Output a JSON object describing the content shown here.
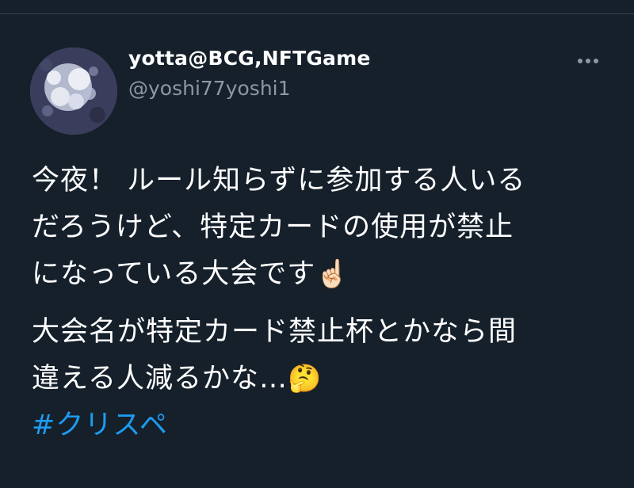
{
  "author": {
    "display_name": "yotta@BCG,NFTGame",
    "handle": "@yoshi77yoshi1"
  },
  "tweet": {
    "paragraph_1": "今夜！ ルール知らずに参加する人いる\nだろうけど、特定カードの使用が禁止\nになっている大会です",
    "paragraph_1_emoji": "☝🏻",
    "paragraph_2": "大会名が特定カード禁止杯とかなら間\n違える人減るかな…",
    "paragraph_2_emoji": "🤔",
    "hashtag": "#クリスペ"
  },
  "icons": {
    "more": "more-horizontal-icon"
  },
  "colors": {
    "background": "#15202b",
    "text": "#ffffff",
    "secondary_text": "#8b98a5",
    "link": "#1d9bf0"
  }
}
